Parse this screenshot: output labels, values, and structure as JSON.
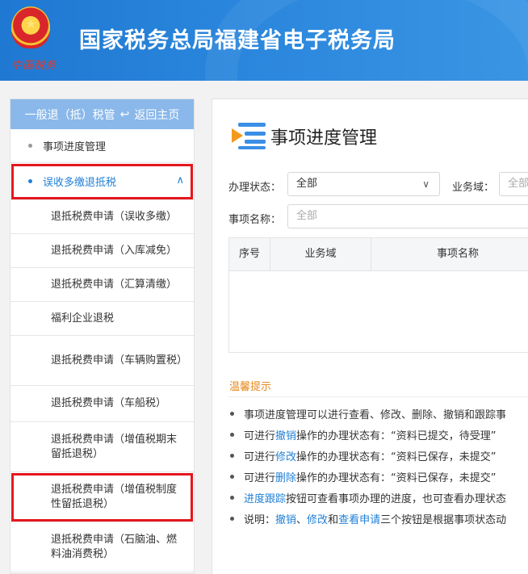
{
  "header": {
    "title": "国家税务总局福建省电子税务局",
    "seal_text": "中国税务"
  },
  "sidebar": {
    "head_label": "一般退（抵）税管",
    "back_label": "返回主页",
    "items": [
      {
        "label": "事项进度管理"
      },
      {
        "label": "误收多缴退抵税"
      }
    ],
    "sub_items": [
      {
        "label": "退抵税费申请（误收多缴）"
      },
      {
        "label": "退抵税费申请（入库减免）"
      },
      {
        "label": "退抵税费申请（汇算清缴）"
      },
      {
        "label": "福利企业退税"
      },
      {
        "label": "退抵税费申请（车辆购置税）"
      },
      {
        "label": "退抵税费申请（车船税）"
      },
      {
        "label": "退抵税费申请（增值税期末留抵退税）"
      },
      {
        "label": "退抵税费申请（增值税制度性留抵退税）"
      },
      {
        "label": "退抵税费申请（石脑油、燃料油消费税）"
      }
    ]
  },
  "main": {
    "title": "事项进度管理",
    "filters": {
      "status_label": "办理状态：",
      "status_value": "全部",
      "domain_label": "业务域：",
      "domain_placeholder": "全部",
      "name_label": "事项名称：",
      "name_placeholder": "全部"
    },
    "table": {
      "columns": [
        "序号",
        "业务域",
        "事项名称"
      ]
    },
    "tips": {
      "title": "温馨提示",
      "lines": [
        {
          "parts": [
            {
              "t": "事项进度管理可以进行查看、修改、删除、撤销和跟踪事"
            }
          ]
        },
        {
          "parts": [
            {
              "t": "可进行"
            },
            {
              "t": "撤销",
              "link": true
            },
            {
              "t": "操作的办理状态有：“资料已提交，待受理”"
            }
          ]
        },
        {
          "parts": [
            {
              "t": "可进行"
            },
            {
              "t": "修改",
              "link": true
            },
            {
              "t": "操作的办理状态有：“资料已保存，未提交”"
            }
          ]
        },
        {
          "parts": [
            {
              "t": "可进行"
            },
            {
              "t": "删除",
              "link": true
            },
            {
              "t": "操作的办理状态有：“资料已保存，未提交”"
            }
          ]
        },
        {
          "parts": [
            {
              "t": "进度跟踪",
              "link": true
            },
            {
              "t": "按钮可查看事项办理的进度，也可查看办理状态"
            }
          ]
        },
        {
          "parts": [
            {
              "t": "说明："
            },
            {
              "t": "撤销",
              "link": true
            },
            {
              "t": "、"
            },
            {
              "t": "修改",
              "link": true
            },
            {
              "t": "和"
            },
            {
              "t": "查看申请",
              "link": true
            },
            {
              "t": "三个按钮是根据事项状态动"
            }
          ]
        }
      ]
    }
  },
  "colors": {
    "header_blue": "#2a86dc",
    "link_blue": "#1f7fd6",
    "highlight_red": "#e5161d",
    "tips_orange": "#e6891e"
  }
}
